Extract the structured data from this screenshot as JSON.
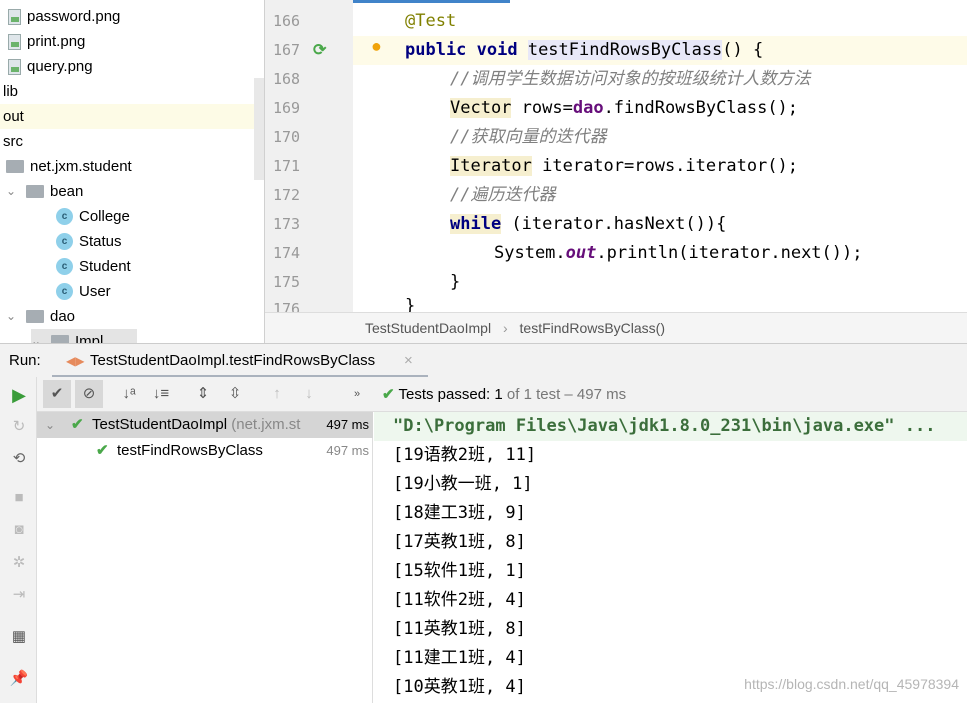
{
  "project": {
    "items": [
      {
        "label": "password.png",
        "type": "image"
      },
      {
        "label": "print.png",
        "type": "image"
      },
      {
        "label": "query.png",
        "type": "image"
      },
      {
        "label": "lib",
        "type": "folder"
      },
      {
        "label": "out",
        "type": "folder"
      },
      {
        "label": "src",
        "type": "folder"
      },
      {
        "label": "net.jxm.student",
        "type": "package"
      },
      {
        "label": "bean",
        "type": "package"
      },
      {
        "label": "College",
        "type": "class"
      },
      {
        "label": "Status",
        "type": "class"
      },
      {
        "label": "Student",
        "type": "class"
      },
      {
        "label": "User",
        "type": "class"
      },
      {
        "label": "dao",
        "type": "package"
      },
      {
        "label": "Impl",
        "type": "package"
      }
    ]
  },
  "editor": {
    "line_numbers": [
      "166",
      "167",
      "168",
      "169",
      "170",
      "171",
      "172",
      "173",
      "174",
      "175",
      "176"
    ],
    "code": {
      "l166": "@Test",
      "l167_kw": "public void ",
      "l167_name": "testFindRowsByClass",
      "l167_rest": "() {",
      "l168": "//调用学生数据访问对象的按班级统计人数方法",
      "l169_type": "Vector",
      "l169_a": " rows=",
      "l169_f": "dao",
      "l169_b": ".findRowsByClass();",
      "l170": "//获取向量的迭代器",
      "l171_type": "Iterator",
      "l171_b": " iterator=rows.iterator();",
      "l172": "//遍历迭代器",
      "l173_kw": "while",
      "l173_b": " (iterator.hasNext()){",
      "l174_a": "System.",
      "l174_f": "out",
      "l174_b": ".println(iterator.next());",
      "l175": "}",
      "l176": "}"
    }
  },
  "breadcrumb": [
    "TestStudentDaoImpl",
    "testFindRowsByClass()"
  ],
  "run": {
    "label": "Run:",
    "tab": "TestStudentDaoImpl.testFindRowsByClass",
    "status_prefix": "Tests passed: ",
    "status_count": "1",
    "status_suffix": " of 1 test – 497 ms"
  },
  "tests": [
    {
      "name": "TestStudentDaoImpl",
      "pkg": "(net.jxm.st",
      "time": "497 ms"
    },
    {
      "name": "testFindRowsByClass",
      "time": "497 ms"
    }
  ],
  "console": [
    "\"D:\\Program Files\\Java\\jdk1.8.0_231\\bin\\java.exe\" ...",
    "[19语教2班, 11]",
    "[19小教一班, 1]",
    "[18建工3班, 9]",
    "[17英教1班, 8]",
    "[15软件1班, 1]",
    "[11软件2班, 4]",
    "[11英教1班, 8]",
    "[11建工1班, 4]",
    "[10英教1班, 4]"
  ],
  "watermark": "https://blog.csdn.net/qq_45978394",
  "colors": {
    "pass": "#4aa84a",
    "keyword": "#000080",
    "comment": "#808080",
    "current_line": "#fefbe8"
  }
}
